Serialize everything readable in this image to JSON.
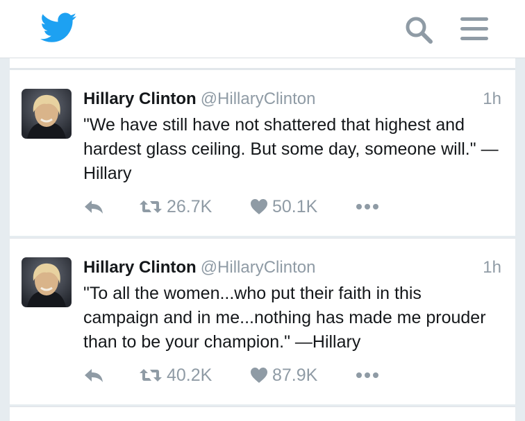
{
  "header": {
    "logo_icon": "twitter-bird-icon",
    "search_icon": "search-icon",
    "menu_icon": "hamburger-menu-icon",
    "accent_color": "#1da1f2",
    "icon_color": "#8f9ba5"
  },
  "tweets": [
    {
      "name": "Hillary Clinton",
      "handle": "@HillaryClinton",
      "time": "1h",
      "text": "\"We have still have not shattered that highest and hardest glass ceiling. But some day, someone will.\" —Hillary",
      "retweets": "26.7K",
      "likes": "50.1K"
    },
    {
      "name": "Hillary Clinton",
      "handle": "@HillaryClinton",
      "time": "1h",
      "text": "\"To all the women...who put their faith in this campaign and in me...nothing has made me prouder than to be your champion.\" —Hillary",
      "retweets": "40.2K",
      "likes": "87.9K"
    }
  ]
}
